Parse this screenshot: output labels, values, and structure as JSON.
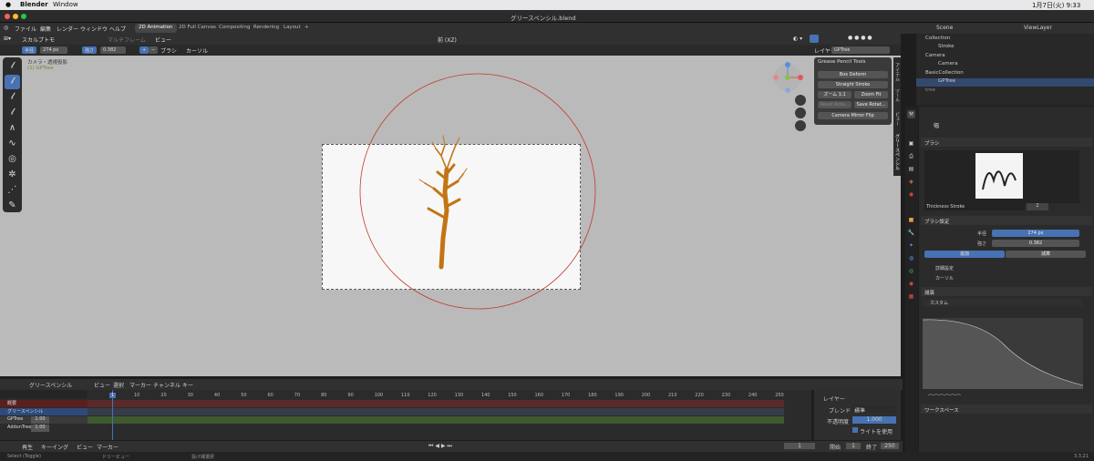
{
  "mac": {
    "app": "Blender",
    "menu": "Window",
    "clock": "1月7日(火) 9:33"
  },
  "window_title": "グリースペンシル.blend",
  "topmenu": {
    "items": [
      "ファイル",
      "編集",
      "レンダー",
      "ウィンドウ",
      "ヘルプ"
    ],
    "workspaces": [
      "2D Animation",
      "2D Full Canvas",
      "Compositing",
      "Rendering",
      "Layout"
    ],
    "add": "+"
  },
  "vp_header": {
    "mode": "スカルプトモ",
    "multiframe": "マルチフレーム",
    "view": "ビュー",
    "orientation": "前 (XZ)"
  },
  "tool_settings": {
    "radius_label": "半径",
    "radius_value": "274 px",
    "strength_label": "強さ",
    "strength_value": "0.382",
    "brush": "ブラシ",
    "cursor": "カーソル"
  },
  "viewport": {
    "camera_label": "カメラ・透視投影",
    "object_label": "(1) GPTree"
  },
  "gp_tools": {
    "title": "Grease Pencil Tools",
    "box": "Box Deform",
    "straight": "Straight Stroke",
    "zoom": "ズーム 1:1",
    "zoomfit": "Zoom Fit",
    "reset": "Reset Rota...",
    "save": "Save Rotat...",
    "flip": "Camera Mirror Flip"
  },
  "side_tabs": [
    "アイテム",
    "ツール",
    "ビュー",
    "グリースペンシル"
  ],
  "layer_header": {
    "label": "レイヤー",
    "value": "GPTree"
  },
  "outliner": {
    "scene": "Scene",
    "viewlayer": "ViewLayer",
    "rows": [
      "Collection",
      "Stroke",
      "Camera",
      "Camera",
      "BasicCollection",
      "GPTree",
      "tree"
    ]
  },
  "props": {
    "header_title": "幅",
    "brush_section": "ブラシ",
    "brush_name": "Thickness Stroke",
    "brush_count": "2",
    "brush_settings": "ブラシ設定",
    "radius_label": "半径",
    "radius": "274 px",
    "strength_label": "強さ",
    "strength": "0.382",
    "add": "追加",
    "subtract": "減算",
    "advanced": "詳細設定",
    "cursor": "カーソル",
    "falloff": "減衰",
    "falloff_preset": "カスタム",
    "workspace": "ワークスペース"
  },
  "dope": {
    "header_items": [
      "グリースペンシル",
      "ビュー",
      "選択",
      "マーカー",
      "チャンネル",
      "キー"
    ],
    "frames": [
      "1",
      "10",
      "20",
      "30",
      "40",
      "50",
      "60",
      "70",
      "80",
      "90",
      "100",
      "110",
      "120",
      "130",
      "140",
      "150",
      "160",
      "170",
      "180",
      "190",
      "200",
      "210",
      "220",
      "230",
      "240",
      "250"
    ],
    "channels": [
      {
        "name": "概要"
      },
      {
        "name": "グリースペンシル"
      },
      {
        "name": "GPTree",
        "value": "1.00"
      },
      {
        "name": "AddonTree",
        "value": "1.00"
      }
    ]
  },
  "layer_panel": {
    "title": "レイヤー",
    "blend_label": "ブレンド",
    "blend": "標準",
    "opacity_label": "不透明度",
    "opacity": "1.000",
    "lights": "ライトを使用"
  },
  "timeline": {
    "playback": "再生",
    "keying": "キーイング",
    "view": "ビュー",
    "marker": "マーカー",
    "current": "1",
    "start_label": "開始",
    "start": "1",
    "end_label": "終了",
    "end": "250"
  },
  "status": {
    "select": "Select (Toggle)",
    "dolly": "ドリービュー",
    "lasso": "投げ縄選択",
    "version": "3.3.21"
  }
}
